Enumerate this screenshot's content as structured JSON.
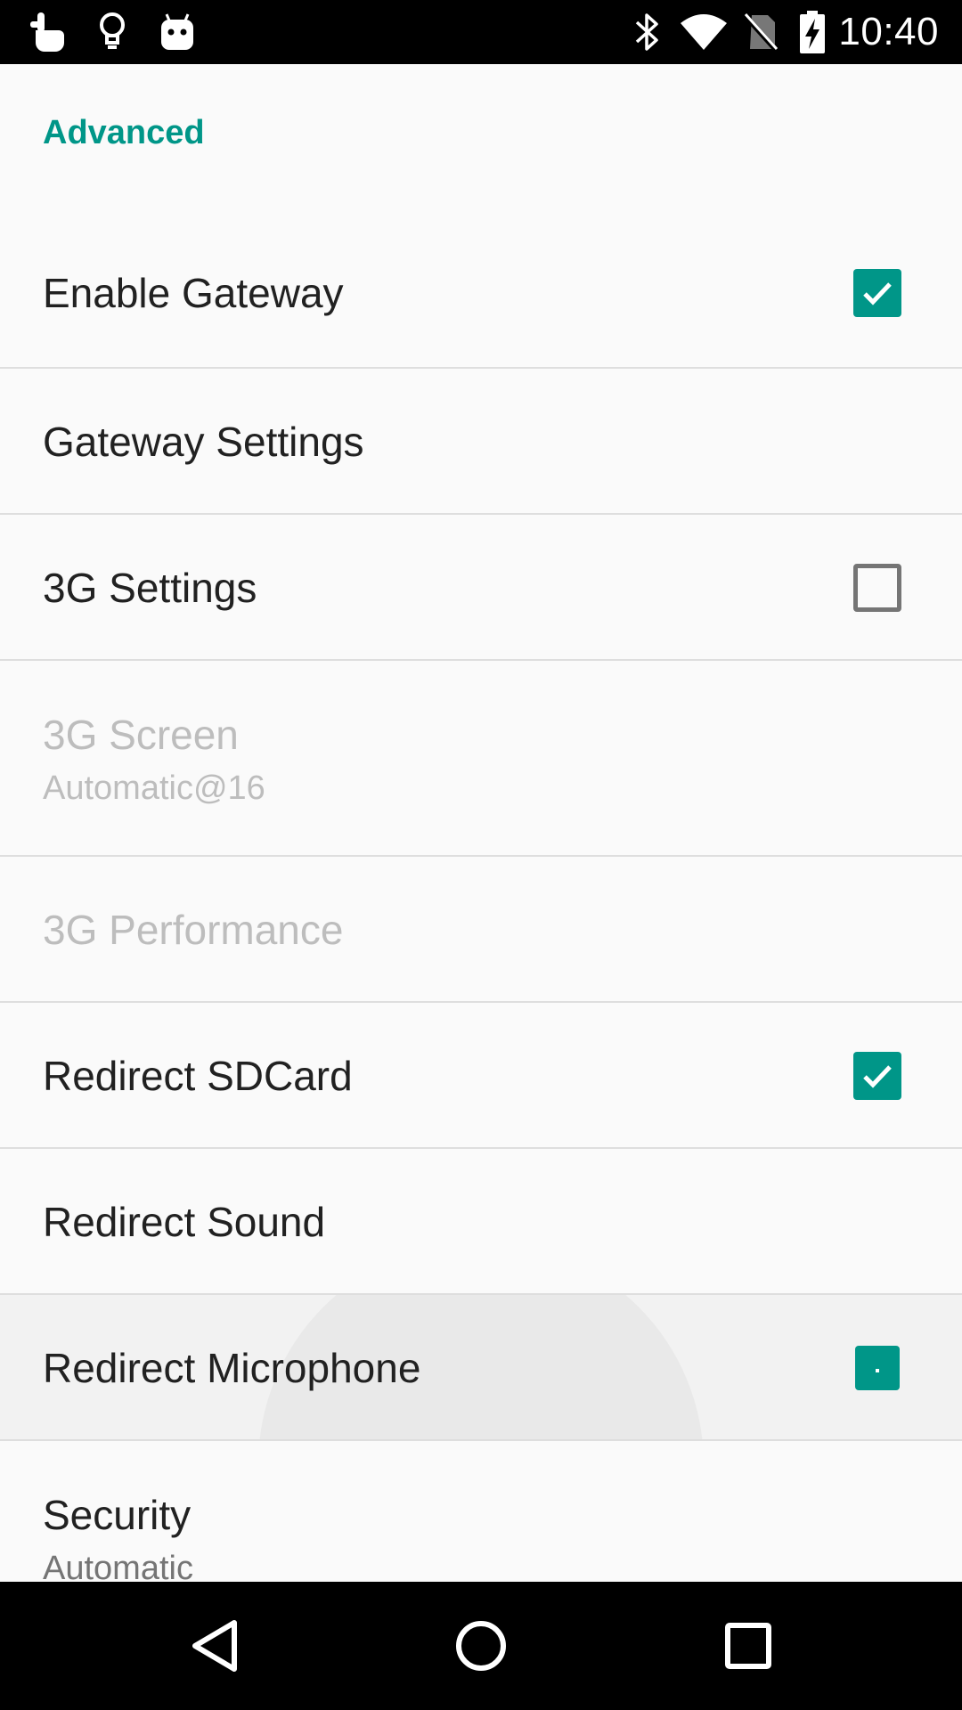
{
  "status_bar": {
    "time": "10:40",
    "left_icons": [
      "hand-pointer-icon",
      "lightbulb-icon",
      "android-icon"
    ],
    "right_icons": [
      "bluetooth-icon",
      "wifi-icon",
      "no-sim-icon",
      "battery-charging-icon"
    ]
  },
  "settings": {
    "category": "Advanced",
    "items": [
      {
        "title": "Enable Gateway",
        "widget": "checkbox",
        "checked": true,
        "enabled": true
      },
      {
        "title": "Gateway Settings",
        "widget": "none",
        "enabled": true
      },
      {
        "title": "3G Settings",
        "widget": "checkbox",
        "checked": false,
        "enabled": true
      },
      {
        "title": "3G Screen",
        "summary": "Automatic@16",
        "widget": "none",
        "enabled": false
      },
      {
        "title": "3G Performance",
        "widget": "none",
        "enabled": false
      },
      {
        "title": "Redirect SDCard",
        "widget": "checkbox",
        "checked": true,
        "enabled": true
      },
      {
        "title": "Redirect Sound",
        "widget": "none",
        "enabled": true
      },
      {
        "title": "Redirect Microphone",
        "widget": "checkbox",
        "checked": true,
        "enabled": true,
        "pressed": true
      },
      {
        "title": "Security",
        "summary": "Automatic",
        "widget": "none",
        "enabled": true
      }
    ]
  },
  "nav_bar": {
    "buttons": [
      "back-icon",
      "home-icon",
      "recents-icon"
    ]
  },
  "colors": {
    "accent": "#009688",
    "status_bar": "#000000",
    "background": "#fafafa",
    "text_primary": "#212121",
    "text_disabled": "#bdbdbd",
    "divider": "#dedede"
  }
}
